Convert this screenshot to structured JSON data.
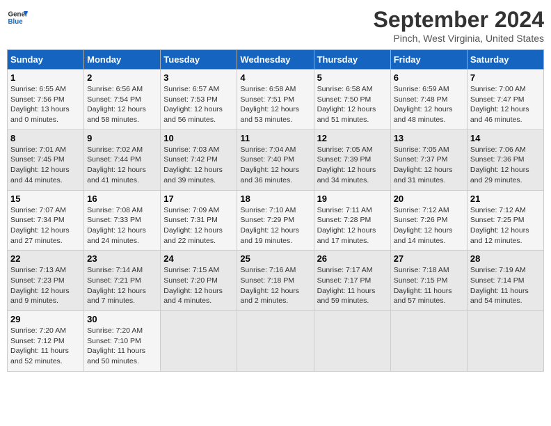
{
  "header": {
    "logo_line1": "General",
    "logo_line2": "Blue",
    "main_title": "September 2024",
    "subtitle": "Pinch, West Virginia, United States"
  },
  "days_of_week": [
    "Sunday",
    "Monday",
    "Tuesday",
    "Wednesday",
    "Thursday",
    "Friday",
    "Saturday"
  ],
  "weeks": [
    [
      {
        "day": "1",
        "info": "Sunrise: 6:55 AM\nSunset: 7:56 PM\nDaylight: 13 hours\nand 0 minutes."
      },
      {
        "day": "2",
        "info": "Sunrise: 6:56 AM\nSunset: 7:54 PM\nDaylight: 12 hours\nand 58 minutes."
      },
      {
        "day": "3",
        "info": "Sunrise: 6:57 AM\nSunset: 7:53 PM\nDaylight: 12 hours\nand 56 minutes."
      },
      {
        "day": "4",
        "info": "Sunrise: 6:58 AM\nSunset: 7:51 PM\nDaylight: 12 hours\nand 53 minutes."
      },
      {
        "day": "5",
        "info": "Sunrise: 6:58 AM\nSunset: 7:50 PM\nDaylight: 12 hours\nand 51 minutes."
      },
      {
        "day": "6",
        "info": "Sunrise: 6:59 AM\nSunset: 7:48 PM\nDaylight: 12 hours\nand 48 minutes."
      },
      {
        "day": "7",
        "info": "Sunrise: 7:00 AM\nSunset: 7:47 PM\nDaylight: 12 hours\nand 46 minutes."
      }
    ],
    [
      {
        "day": "8",
        "info": "Sunrise: 7:01 AM\nSunset: 7:45 PM\nDaylight: 12 hours\nand 44 minutes."
      },
      {
        "day": "9",
        "info": "Sunrise: 7:02 AM\nSunset: 7:44 PM\nDaylight: 12 hours\nand 41 minutes."
      },
      {
        "day": "10",
        "info": "Sunrise: 7:03 AM\nSunset: 7:42 PM\nDaylight: 12 hours\nand 39 minutes."
      },
      {
        "day": "11",
        "info": "Sunrise: 7:04 AM\nSunset: 7:40 PM\nDaylight: 12 hours\nand 36 minutes."
      },
      {
        "day": "12",
        "info": "Sunrise: 7:05 AM\nSunset: 7:39 PM\nDaylight: 12 hours\nand 34 minutes."
      },
      {
        "day": "13",
        "info": "Sunrise: 7:05 AM\nSunset: 7:37 PM\nDaylight: 12 hours\nand 31 minutes."
      },
      {
        "day": "14",
        "info": "Sunrise: 7:06 AM\nSunset: 7:36 PM\nDaylight: 12 hours\nand 29 minutes."
      }
    ],
    [
      {
        "day": "15",
        "info": "Sunrise: 7:07 AM\nSunset: 7:34 PM\nDaylight: 12 hours\nand 27 minutes."
      },
      {
        "day": "16",
        "info": "Sunrise: 7:08 AM\nSunset: 7:33 PM\nDaylight: 12 hours\nand 24 minutes."
      },
      {
        "day": "17",
        "info": "Sunrise: 7:09 AM\nSunset: 7:31 PM\nDaylight: 12 hours\nand 22 minutes."
      },
      {
        "day": "18",
        "info": "Sunrise: 7:10 AM\nSunset: 7:29 PM\nDaylight: 12 hours\nand 19 minutes."
      },
      {
        "day": "19",
        "info": "Sunrise: 7:11 AM\nSunset: 7:28 PM\nDaylight: 12 hours\nand 17 minutes."
      },
      {
        "day": "20",
        "info": "Sunrise: 7:12 AM\nSunset: 7:26 PM\nDaylight: 12 hours\nand 14 minutes."
      },
      {
        "day": "21",
        "info": "Sunrise: 7:12 AM\nSunset: 7:25 PM\nDaylight: 12 hours\nand 12 minutes."
      }
    ],
    [
      {
        "day": "22",
        "info": "Sunrise: 7:13 AM\nSunset: 7:23 PM\nDaylight: 12 hours\nand 9 minutes."
      },
      {
        "day": "23",
        "info": "Sunrise: 7:14 AM\nSunset: 7:21 PM\nDaylight: 12 hours\nand 7 minutes."
      },
      {
        "day": "24",
        "info": "Sunrise: 7:15 AM\nSunset: 7:20 PM\nDaylight: 12 hours\nand 4 minutes."
      },
      {
        "day": "25",
        "info": "Sunrise: 7:16 AM\nSunset: 7:18 PM\nDaylight: 12 hours\nand 2 minutes."
      },
      {
        "day": "26",
        "info": "Sunrise: 7:17 AM\nSunset: 7:17 PM\nDaylight: 11 hours\nand 59 minutes."
      },
      {
        "day": "27",
        "info": "Sunrise: 7:18 AM\nSunset: 7:15 PM\nDaylight: 11 hours\nand 57 minutes."
      },
      {
        "day": "28",
        "info": "Sunrise: 7:19 AM\nSunset: 7:14 PM\nDaylight: 11 hours\nand 54 minutes."
      }
    ],
    [
      {
        "day": "29",
        "info": "Sunrise: 7:20 AM\nSunset: 7:12 PM\nDaylight: 11 hours\nand 52 minutes."
      },
      {
        "day": "30",
        "info": "Sunrise: 7:20 AM\nSunset: 7:10 PM\nDaylight: 11 hours\nand 50 minutes."
      },
      null,
      null,
      null,
      null,
      null
    ]
  ]
}
